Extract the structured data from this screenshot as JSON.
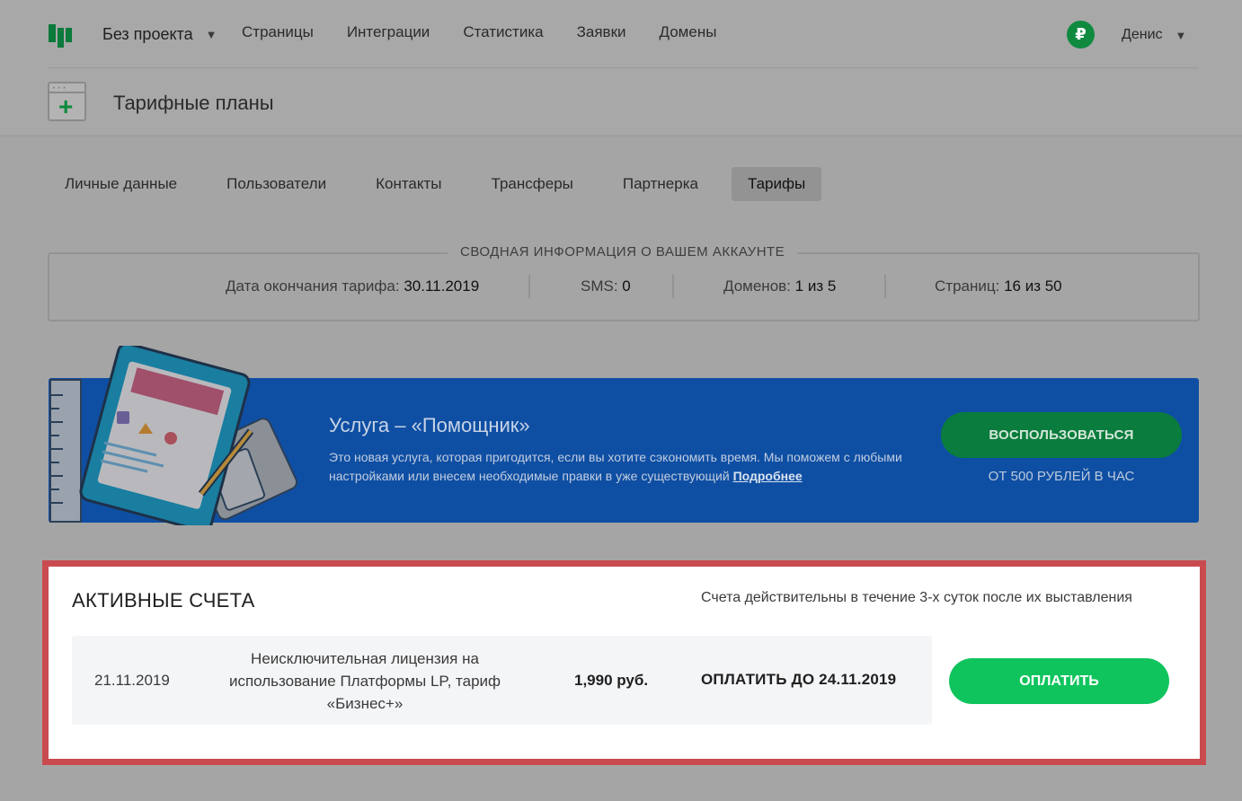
{
  "header": {
    "project_label": "Без проекта",
    "nav": [
      "Страницы",
      "Интеграции",
      "Статистика",
      "Заявки",
      "Домены"
    ],
    "currency_icon": "₽",
    "user_name": "Денис"
  },
  "page": {
    "title": "Тарифные планы"
  },
  "tabs": [
    {
      "label": "Личные данные",
      "active": false
    },
    {
      "label": "Пользователи",
      "active": false
    },
    {
      "label": "Контакты",
      "active": false
    },
    {
      "label": "Трансферы",
      "active": false
    },
    {
      "label": "Партнерка",
      "active": false
    },
    {
      "label": "Тарифы",
      "active": true
    }
  ],
  "summary": {
    "title": "СВОДНАЯ ИНФОРМАЦИЯ О ВАШЕМ АККАУНТЕ",
    "tariff_end_label": "Дата окончания тарифа:",
    "tariff_end_value": "30.11.2019",
    "sms_label": "SMS:",
    "sms_value": "0",
    "domains_label": "Доменов:",
    "domains_value": "1 из 5",
    "pages_label": "Страниц:",
    "pages_value": "16 из 50"
  },
  "promo": {
    "title": "Услуга – «Помощник»",
    "text": "Это новая услуга, которая пригодится, если вы хотите сэкономить время. Мы поможем с любыми настройками или внесем необходимые правки в уже существующий",
    "link": "Подробнее",
    "button": "ВОСПОЛЬЗОВАТЬСЯ",
    "price": "ОТ 500 РУБЛЕЙ В ЧАС"
  },
  "invoices": {
    "title": "АКТИВНЫЕ СЧЕТА",
    "note": "Счета действительны в течение 3-х суток после их выставления",
    "items": [
      {
        "date": "21.11.2019",
        "description": "Неисключительная лицензия на использование Платформы LP, тариф «Бизнес+»",
        "amount": "1,990 руб.",
        "due": "ОПЛАТИТЬ ДО 24.11.2019",
        "pay_label": "ОПЛАТИТЬ"
      }
    ]
  },
  "colors": {
    "brand_green": "#0b7a3a",
    "promo_blue": "#0f4fa3",
    "pay_green": "#10c45d",
    "highlight_red": "#c94b4f"
  }
}
